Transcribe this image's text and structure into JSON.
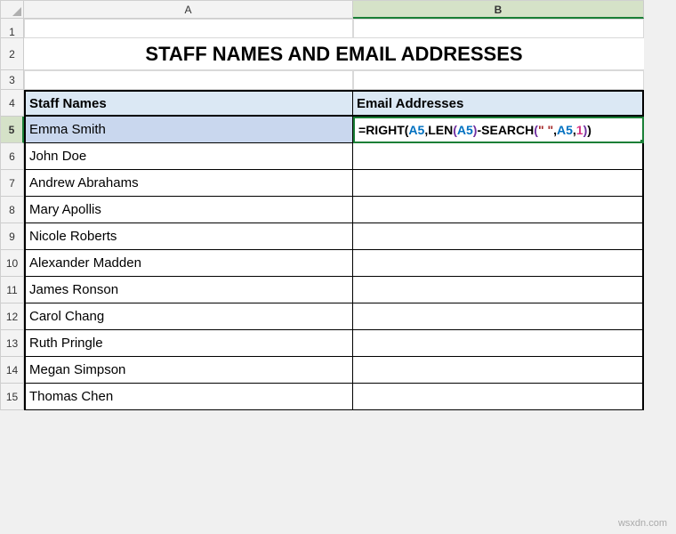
{
  "columns": {
    "A": "A",
    "B": "B"
  },
  "title": "STAFF NAMES AND EMAIL ADDRESSES",
  "headers": {
    "names": "Staff Names",
    "emails": "Email Addresses"
  },
  "rows": [
    {
      "num": 1
    },
    {
      "num": 2
    },
    {
      "num": 3
    },
    {
      "num": 4
    },
    {
      "num": 5,
      "name": "Emma Smith"
    },
    {
      "num": 6,
      "name": "John Doe"
    },
    {
      "num": 7,
      "name": "Andrew Abrahams"
    },
    {
      "num": 8,
      "name": "Mary Apollis"
    },
    {
      "num": 9,
      "name": "Nicole Roberts"
    },
    {
      "num": 10,
      "name": "Alexander Madden"
    },
    {
      "num": 11,
      "name": "James Ronson"
    },
    {
      "num": 12,
      "name": "Carol Chang"
    },
    {
      "num": 13,
      "name": "Ruth Pringle"
    },
    {
      "num": 14,
      "name": "Megan Simpson"
    },
    {
      "num": 15,
      "name": "Thomas Chen"
    }
  ],
  "formula": {
    "raw": "=RIGHT(A5,LEN(A5)-SEARCH(\" \",A5,1))",
    "tokens": [
      {
        "t": "=",
        "c": "fx-black"
      },
      {
        "t": "RIGHT",
        "c": "fx-black"
      },
      {
        "t": "(",
        "c": "fx-paren1"
      },
      {
        "t": "A5",
        "c": "fx-blue"
      },
      {
        "t": ",",
        "c": "fx-black"
      },
      {
        "t": "LEN",
        "c": "fx-black"
      },
      {
        "t": "(",
        "c": "fx-paren2"
      },
      {
        "t": "A5",
        "c": "fx-blue"
      },
      {
        "t": ")",
        "c": "fx-paren2"
      },
      {
        "t": "-",
        "c": "fx-black"
      },
      {
        "t": "SEARCH",
        "c": "fx-black"
      },
      {
        "t": "(",
        "c": "fx-paren2"
      },
      {
        "t": "\" \"",
        "c": "fx-str"
      },
      {
        "t": ",",
        "c": "fx-black"
      },
      {
        "t": "A5",
        "c": "fx-blue"
      },
      {
        "t": ",",
        "c": "fx-black"
      },
      {
        "t": "1",
        "c": "fx-num"
      },
      {
        "t": ")",
        "c": "fx-paren2"
      },
      {
        "t": ")",
        "c": "fx-paren1"
      }
    ]
  },
  "watermark": "wsxdn.com",
  "chart_data": {
    "type": "table",
    "title": "STAFF NAMES AND EMAIL ADDRESSES",
    "columns": [
      "Staff Names",
      "Email Addresses"
    ],
    "rows": [
      [
        "Emma Smith",
        "=RIGHT(A5,LEN(A5)-SEARCH(\" \",A5,1))"
      ],
      [
        "John Doe",
        ""
      ],
      [
        "Andrew Abrahams",
        ""
      ],
      [
        "Mary Apollis",
        ""
      ],
      [
        "Nicole Roberts",
        ""
      ],
      [
        "Alexander Madden",
        ""
      ],
      [
        "James Ronson",
        ""
      ],
      [
        "Carol Chang",
        ""
      ],
      [
        "Ruth Pringle",
        ""
      ],
      [
        "Megan Simpson",
        ""
      ],
      [
        "Thomas Chen",
        ""
      ]
    ]
  }
}
